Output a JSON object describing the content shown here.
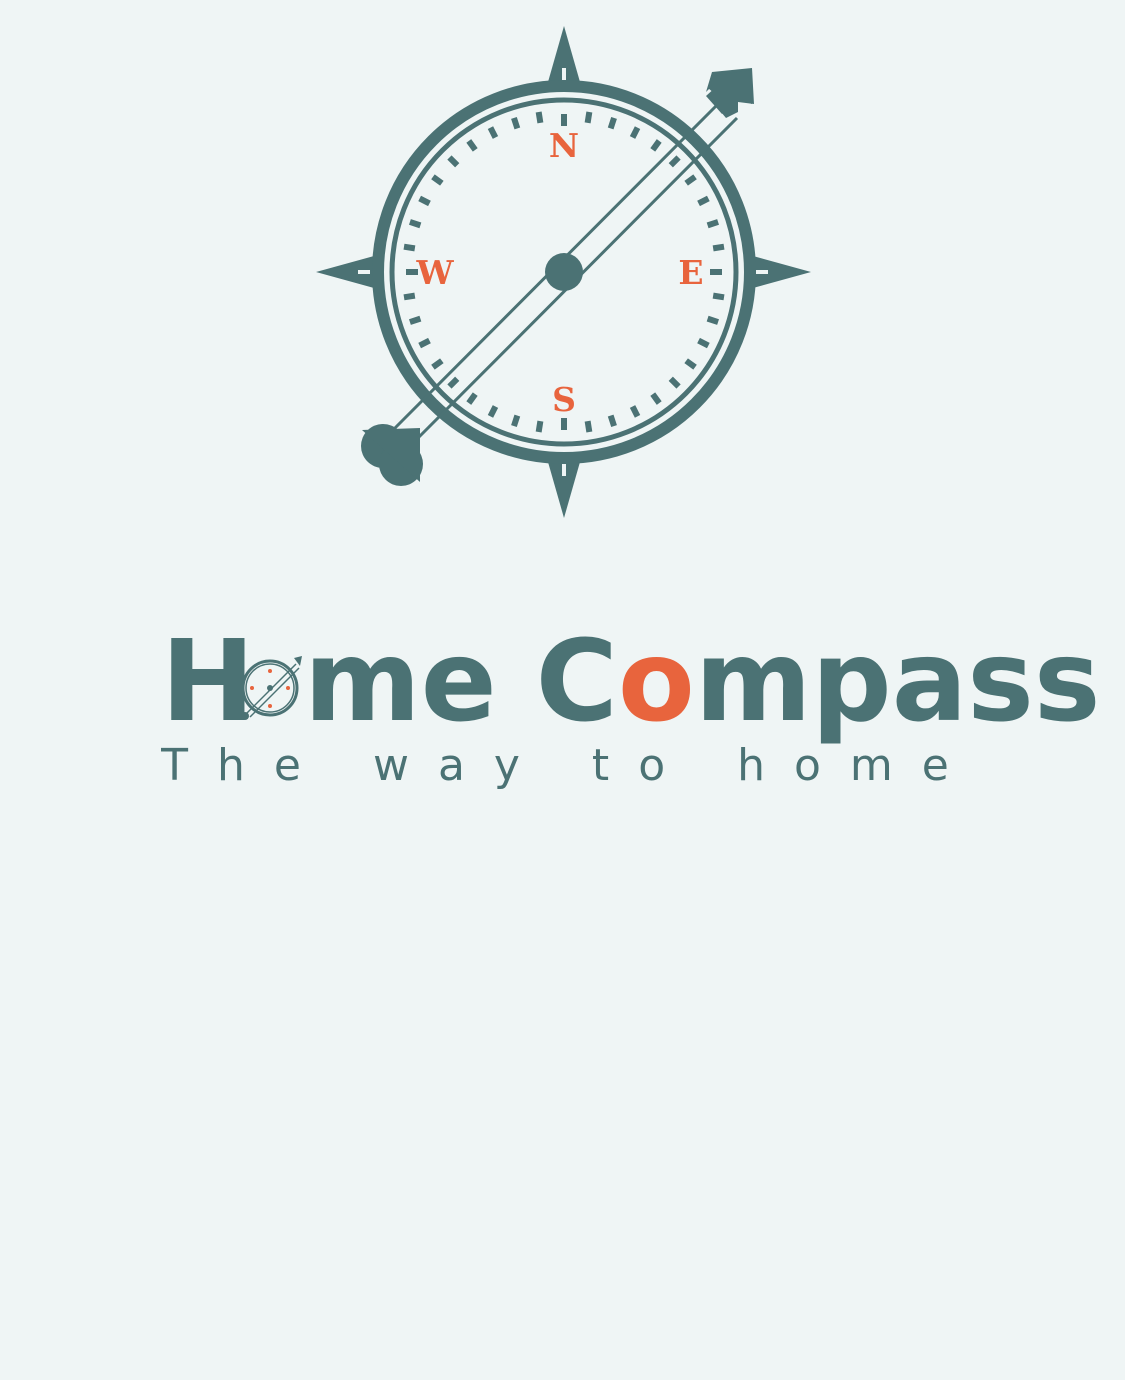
{
  "brand": {
    "title_part_1": "H",
    "title_part_2": "me C",
    "title_accent": "o",
    "title_part_3": "mpass",
    "tagline": "The way to home"
  },
  "compass": {
    "north": "N",
    "south": "S",
    "east": "E",
    "west": "W"
  },
  "colors": {
    "background": "#eff5f5",
    "primary": "#4b7274",
    "accent": "#e8643d"
  },
  "icons": {
    "emblem": "compass-icon",
    "title_o": "compass-icon"
  }
}
